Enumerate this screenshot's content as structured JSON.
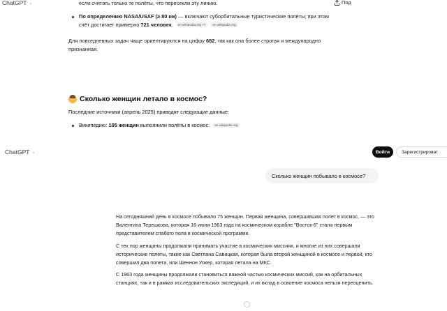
{
  "top": {
    "app_title": "ChatGPT",
    "share_label": "Под"
  },
  "answer1": {
    "line_top": "если считать только те полёты, что пересекли эту линию.",
    "bullet_bold": "По определению NASA/USAF (≥ 80 км)",
    "bullet_rest": " — включают суборбитальные туристические полёты; при этом счёт достигает примерно ",
    "bullet_num": "721 человек",
    "bullet_end": ".",
    "src1": "en.wikipedia.org +7",
    "src2": "en.wikipedia.org",
    "para_a": "Для повседневных задач чаще ориентируются на цифру ",
    "para_num": "682",
    "para_b": ", так как она более строгая и международно признанная."
  },
  "section": {
    "title": "Сколько женщин летало в космос?",
    "intro": "Последние источники (апрель 2025) приводят следующие данные:",
    "bullet_a": "Википедию: ",
    "bullet_bold": "105 женщин",
    "bullet_b": " выполнили полёты в космос.",
    "src": "en.wikipedia.org"
  },
  "header2": {
    "app_title": "ChatGPT",
    "login": "Войти",
    "signup": "Зарегистрироват"
  },
  "user_message": "Сколько женщин побывало в космосе?",
  "answer2": {
    "p1": "На сегодняшний день в космосе побывало 75 женщин. Первая женщина, совершившая полет в космос, — это Валентина Терешкова, которая 16 июня 1963 года на космическом корабле \"Восток-6\" стала первым представителем слабого пола в космической программе.",
    "p2": "С тех пор женщины продолжали принимать участие в космических миссиях, и многие из них совершали исторические полеты, такие как Светлана Савицкая, которая была второй женщиной в космосе и первой, кто совершил два полета, или Шеннон Уокер, которая летала на МКС.",
    "p3": "С 1963 года женщины продолжали становиться важной частью космических миссий, как на орбитальных станциях, так и в рамках исследовательских экспедиций, и их вклад в освоение космоса нельзя переоценить."
  },
  "icons": {
    "chevron": "chevron-down-icon",
    "share": "share-icon",
    "emoji": "woman-astronaut-emoji-icon",
    "scroll": "scroll-down-icon"
  }
}
